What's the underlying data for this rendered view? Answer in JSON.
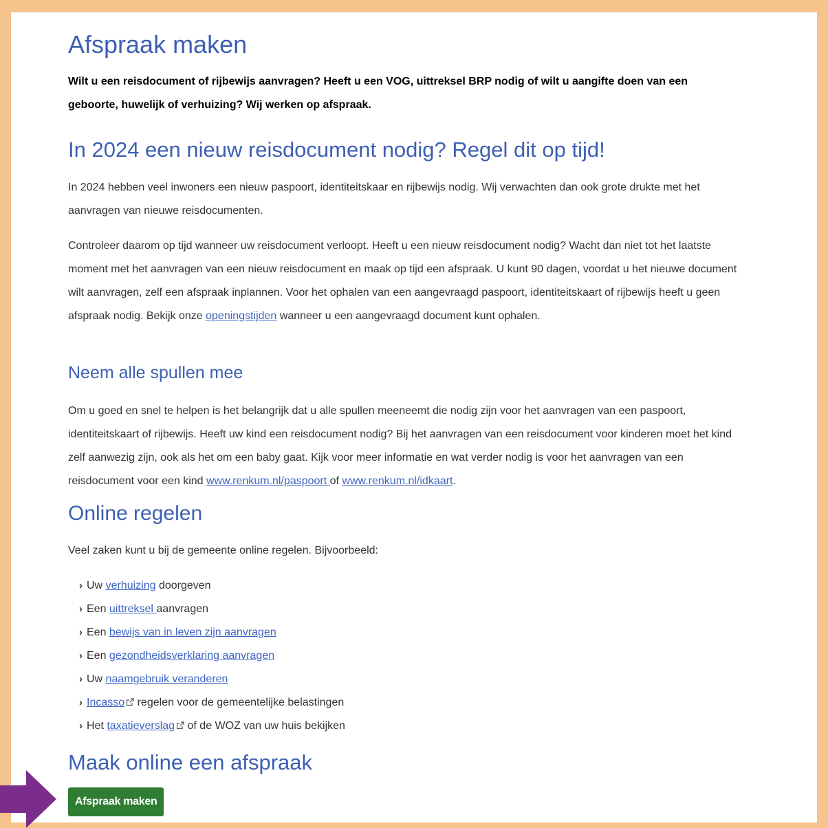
{
  "title": "Afspraak maken",
  "intro": "Wilt u een reisdocument of rijbewijs aanvragen? Heeft u een VOG, uittreksel BRP nodig of wilt u aangifte doen van een geboorte, huwelijk of verhuizing? Wij werken op afspraak.",
  "section_2024": {
    "heading": "In 2024 een nieuw reisdocument nodig? Regel dit op tijd!",
    "p1": "In 2024 hebben veel inwoners een nieuw paspoort, identiteitskaar en rijbewijs nodig. Wij verwachten dan ook grote drukte met het aanvragen van nieuwe reisdocumenten.",
    "p2_before": "Controleer daarom op tijd wanneer uw reisdocument verloopt. Heeft u een nieuw reisdocument nodig? Wacht dan niet tot het laatste moment met het aanvragen van een nieuw reisdocument en maak op tijd een afspraak. U kunt 90 dagen, voordat u het nieuwe document wilt aanvragen, zelf een afspraak inplannen. Voor het ophalen van een aangevraagd paspoort, identiteitskaart of rijbewijs heeft u geen afspraak nodig. Bekijk onze ",
    "p2_link": "openingstijden",
    "p2_after": " wanneer u een aangevraagd document kunt ophalen."
  },
  "section_spullen": {
    "heading": "Neem alle spullen mee",
    "p_before": "Om u goed en snel te helpen is het belangrijk dat u alle spullen meeneemt die nodig zijn voor het aanvragen van een paspoort, identiteitskaart of rijbewijs. Heeft uw kind een reisdocument nodig? Bij het aanvragen van een reisdocument voor kinderen moet het kind zelf aanwezig zijn, ook als het om een baby gaat. Kijk voor meer informatie en wat verder nodig is voor het aanvragen van een reisdocument voor een kind ",
    "link1": "www.renkum.nl/paspoort ",
    "p_mid": "of ",
    "link2": "www.renkum.nl/idkaart",
    "p_after": "."
  },
  "section_online": {
    "heading": "Online regelen",
    "intro": "Veel zaken kunt u bij de gemeente online regelen. Bijvoorbeeld:",
    "items": [
      {
        "before": "Uw ",
        "link": "verhuizing",
        "after": " doorgeven"
      },
      {
        "before": "Een ",
        "link": "uittreksel ",
        "after": "aanvragen"
      },
      {
        "before": "Een ",
        "link": "bewijs van in leven zijn aanvragen",
        "after": ""
      },
      {
        "before": "Een ",
        "link": "gezondheidsverklaring aanvragen",
        "after": ""
      },
      {
        "before": "Uw ",
        "link": "naamgebruik veranderen",
        "after": ""
      },
      {
        "before": "",
        "link": "Incasso",
        "after": " regelen voor de gemeentelijke belastingen"
      },
      {
        "before": "Het ",
        "link": "taxatieverslag",
        "after": " of de WOZ van uw huis bekijken"
      }
    ]
  },
  "section_afspraak": {
    "heading": "Maak online een afspraak",
    "button": "Afspraak maken"
  },
  "colors": {
    "heading": "#3c5fb3",
    "link": "#3d64c2",
    "button": "#2e7d32",
    "frame": "#f5c48c",
    "arrow": "#7b2d8b"
  }
}
